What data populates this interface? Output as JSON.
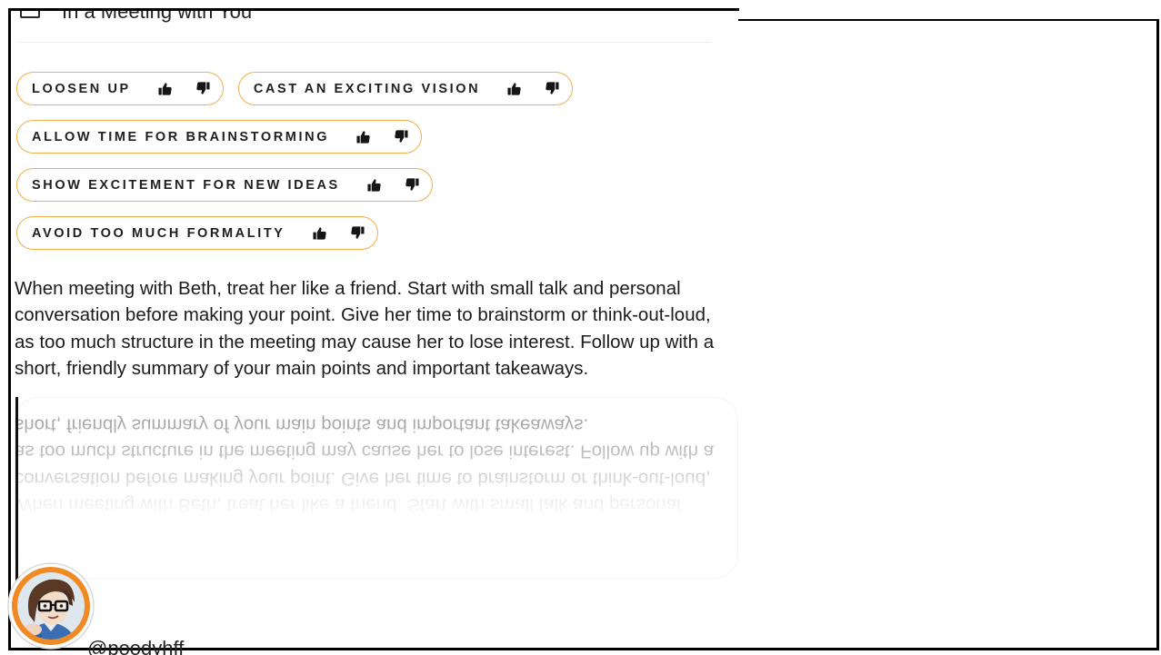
{
  "theme": {
    "accent_color": "#f3ae4b",
    "text_color": "#1b1b1b",
    "avatar_ring_color": "#f08a24"
  },
  "icons": {
    "checkbox": "checkbox-icon",
    "like": "thumbs-up-icon",
    "dislike": "thumbs-down-icon",
    "avatar": "avatar-illustration"
  },
  "section": {
    "title": "In a Meeting with You",
    "checked": false
  },
  "tips": [
    {
      "label": "LOOSEN UP"
    },
    {
      "label": "CAST AN EXCITING VISION"
    },
    {
      "label": "ALLOW TIME FOR BRAINSTORMING"
    },
    {
      "label": "SHOW EXCITEMENT FOR NEW IDEAS"
    },
    {
      "label": "AVOID TOO MUCH FORMALITY"
    }
  ],
  "advice": {
    "text": "When meeting with Beth, treat her like a friend. Start with small talk and personal conversation before making your point. Give her time to brainstorm or think-out-loud, as too much structure in the meeting may cause her to lose interest. Follow up with a short, friendly summary of your main points and important takeaways."
  },
  "presenter": {
    "handle": "@poodyhff"
  }
}
